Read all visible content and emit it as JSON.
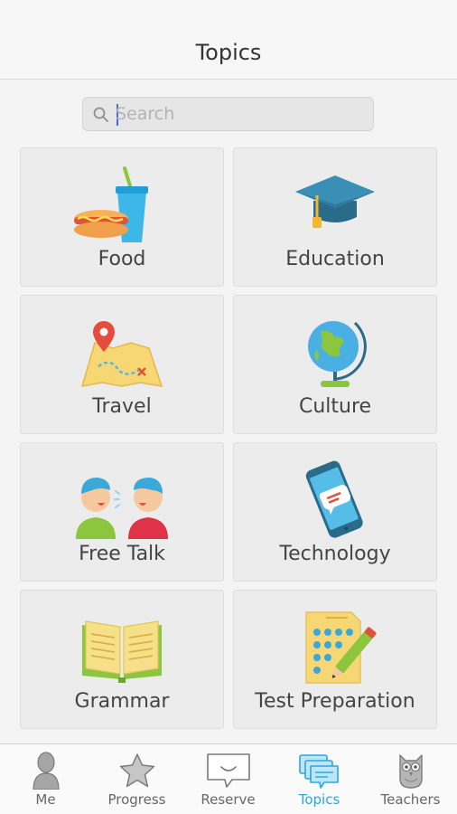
{
  "header": {
    "title": "Topics"
  },
  "search": {
    "placeholder": "Search",
    "value": ""
  },
  "topics": [
    {
      "label": "Food",
      "icon": "food-icon"
    },
    {
      "label": "Education",
      "icon": "graduation-cap-icon"
    },
    {
      "label": "Travel",
      "icon": "map-icon"
    },
    {
      "label": "Culture",
      "icon": "globe-icon"
    },
    {
      "label": "Free Talk",
      "icon": "people-talking-icon"
    },
    {
      "label": "Technology",
      "icon": "phone-icon"
    },
    {
      "label": "Grammar",
      "icon": "book-icon"
    },
    {
      "label": "Test Preparation",
      "icon": "test-sheet-icon"
    }
  ],
  "tabbar": {
    "items": [
      {
        "label": "Me",
        "icon": "person-icon"
      },
      {
        "label": "Progress",
        "icon": "star-icon"
      },
      {
        "label": "Reserve",
        "icon": "chat-bubble-icon"
      },
      {
        "label": "Topics",
        "icon": "topics-icon",
        "active": true
      },
      {
        "label": "Teachers",
        "icon": "owl-icon"
      }
    ]
  },
  "colors": {
    "accent": "#2aa6e0",
    "tile_bg": "#ececec",
    "page_bg": "#f4f4f4"
  }
}
